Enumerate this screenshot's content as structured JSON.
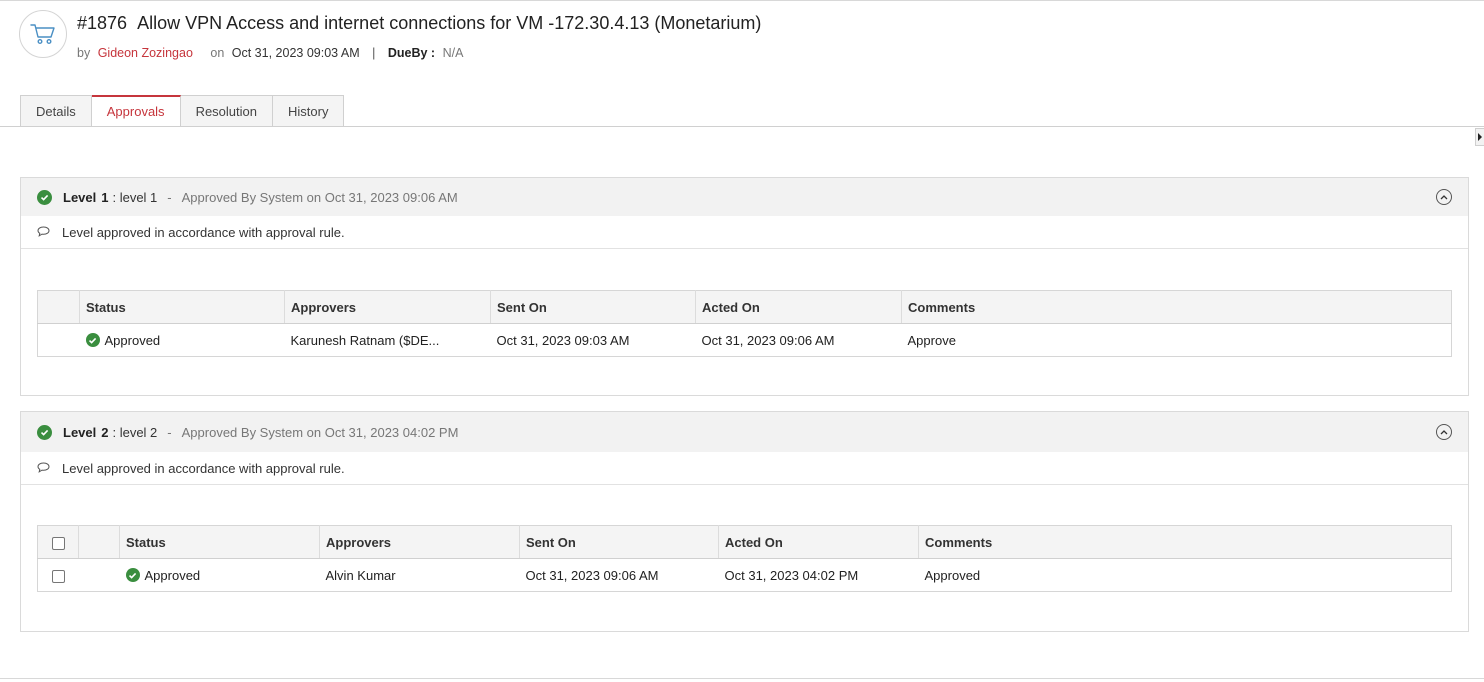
{
  "request": {
    "id": "#1876",
    "title": "Allow VPN Access and internet connections for VM -172.30.4.13 (Monetarium)",
    "by_label": "by",
    "author": "Gideon Zozingao",
    "on_label": "on",
    "date": "Oct 31, 2023 09:03 AM",
    "separator": "|",
    "dueby_label": "DueBy :",
    "dueby_value": "N/A"
  },
  "tabs": [
    {
      "label": "Details"
    },
    {
      "label": "Approvals"
    },
    {
      "label": "Resolution"
    },
    {
      "label": "History"
    }
  ],
  "levels": [
    {
      "word": "Level",
      "number": "1",
      "name": ": level 1",
      "dash": "-",
      "status": "Approved By System on Oct 31, 2023 09:06 AM",
      "note": "Level approved in accordance with approval rule.",
      "columns": [
        "Status",
        "Approvers",
        "Sent On",
        "Acted On",
        "Comments"
      ],
      "rows": [
        {
          "status": "Approved",
          "approver": "Karunesh Ratnam ($DE...",
          "sent_on": "Oct 31, 2023 09:03 AM",
          "acted_on": "Oct 31, 2023 09:06 AM",
          "comments": "Approve"
        }
      ]
    },
    {
      "word": "Level",
      "number": "2",
      "name": ": level 2",
      "dash": "-",
      "status": "Approved By System on Oct 31, 2023 04:02 PM",
      "note": "Level approved in accordance with approval rule.",
      "columns": [
        "Status",
        "Approvers",
        "Sent On",
        "Acted On",
        "Comments"
      ],
      "rows": [
        {
          "status": "Approved",
          "approver": "Alvin Kumar",
          "sent_on": "Oct 31, 2023 09:06 AM",
          "acted_on": "Oct 31, 2023 04:02 PM",
          "comments": "Approved"
        }
      ]
    }
  ],
  "colors": {
    "accent": "#c6353c",
    "success": "#3a8e3f"
  },
  "icons": {
    "header": "cart-icon",
    "status": "check-circle-icon",
    "note": "comment-icon",
    "collapse": "chevron-up-icon"
  }
}
